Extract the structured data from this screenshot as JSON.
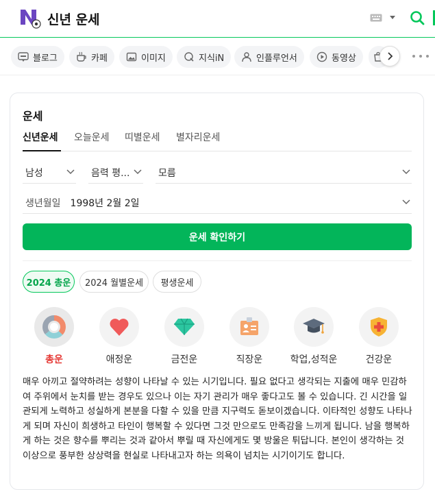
{
  "header": {
    "title": "신년 운세",
    "logo_icon": "naver-n-logo-icon",
    "keyboard_icon": "keyboard-icon",
    "search_icon": "search-icon",
    "accent": "#03c75a"
  },
  "tabs": [
    {
      "label": "블로그",
      "icon": "blog-icon"
    },
    {
      "label": "카페",
      "icon": "cafe-icon"
    },
    {
      "label": "이미지",
      "icon": "image-icon"
    },
    {
      "label": "지식iN",
      "icon": "kin-icon"
    },
    {
      "label": "인플루언서",
      "icon": "person-icon"
    },
    {
      "label": "동영상",
      "icon": "play-icon"
    },
    {
      "label": "",
      "icon": "shopping-icon"
    }
  ],
  "card": {
    "title": "운세",
    "subtabs": [
      "신년운세",
      "오늘운세",
      "띠별운세",
      "별자리운세"
    ],
    "gender_select": "남성",
    "calendar_select": "음력 평...",
    "time_select": "모름",
    "birth_label": "생년월일",
    "birth_value": "1998년 2월 2일",
    "confirm_label": "운세 확인하기",
    "chips": [
      "2024 총운",
      "2024 월별운세",
      "평생운세"
    ],
    "categories": [
      {
        "label": "총운",
        "icon": "pie-chart-icon"
      },
      {
        "label": "애정운",
        "icon": "heart-icon"
      },
      {
        "label": "금전운",
        "icon": "gem-icon"
      },
      {
        "label": "직장운",
        "icon": "id-badge-icon"
      },
      {
        "label": "학업,성적운",
        "icon": "graduation-cap-icon"
      },
      {
        "label": "건강운",
        "icon": "health-shield-icon"
      }
    ],
    "description": "매우 아끼고 절약하려는 성향이 나타날 수 있는 시기입니다. 필요 없다고 생각되는 지출에 매우 민감하여 주위에서 눈치를 받는 경우도 있으나 이는 자기 관리가 매우 좋다고도 볼 수 있습니다. 긴 시간을 일관되게 노력하고 성실하게 본분을 다할 수 있을 만큼 지구력도 돋보이겠습니다. 이타적인 성향도 나타나게 되며 자신이 희생하고 타인이 행복할 수 있다면 그것 만으로도 만족감을 느끼게 됩니다. 남을 행복하게 하는 것은 향수를 뿌리는 것과 같아서 뿌릴 때 자신에게도 몇 방울은 튀답니다. 본인이 생각하는 것 이상으로 풍부한 상상력을 현실로 나타내고자 하는 의욕이 넘치는 시기이기도 합니다."
  }
}
